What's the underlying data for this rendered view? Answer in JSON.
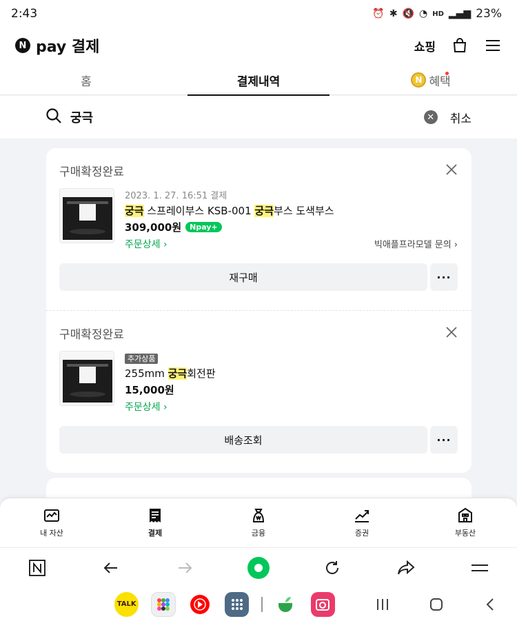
{
  "status_bar": {
    "time": "2:43",
    "network": "HD",
    "battery": "23%"
  },
  "header": {
    "logo_mark": "N",
    "logo_text": "pay 결제",
    "shopping_label": "쇼핑"
  },
  "tabs": [
    {
      "label": "홈"
    },
    {
      "label": "결제내역"
    },
    {
      "label": "혜택",
      "coin": "N"
    }
  ],
  "search": {
    "query": "궁극",
    "cancel_label": "취소"
  },
  "orders": [
    {
      "status": "구매확정완료",
      "date": "2023. 1. 27. 16:51 결제",
      "name_parts": [
        "궁극",
        " 스프레이부스 KSB-001 ",
        "궁극",
        "부스 도색부스"
      ],
      "price": "309,000원",
      "npay_badge": "Npay+",
      "detail_link": "주문상세 ›",
      "seller_link": "빅애플프라모델 문의 ›",
      "action_label": "재구매",
      "more_label": "···"
    },
    {
      "status": "구매확정완료",
      "addon_badge": "추가상품",
      "name_parts": [
        "255mm ",
        "궁극",
        "회전판"
      ],
      "price": "15,000원",
      "detail_link": "주문상세 ›",
      "action_label": "배송조회",
      "more_label": "···"
    }
  ],
  "bottom_nav": [
    {
      "label": "내 자산",
      "icon": "wallet-chart-icon"
    },
    {
      "label": "결제",
      "icon": "receipt-icon"
    },
    {
      "label": "금융",
      "icon": "money-bag-icon"
    },
    {
      "label": "증권",
      "icon": "stock-chart-icon"
    },
    {
      "label": "부동산",
      "icon": "building-icon"
    }
  ],
  "dock": {
    "kakao_label": "TALK"
  },
  "colors": {
    "npay_green": "#03c75a",
    "highlight": "#fff27a",
    "link_green": "#03a54c"
  }
}
